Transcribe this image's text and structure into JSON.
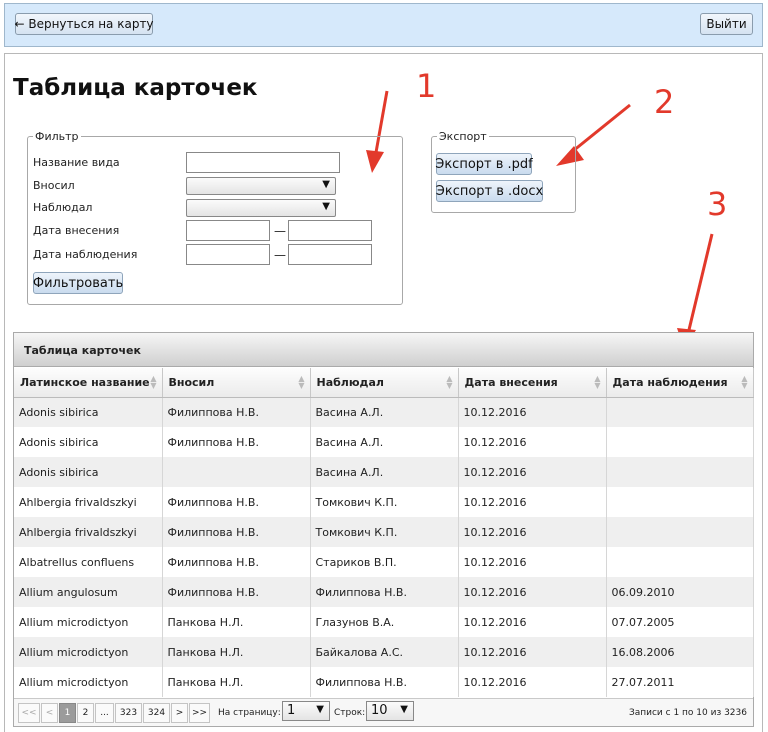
{
  "topbar": {
    "back_label": "← Вернуться на карту",
    "exit_label": "Выйти"
  },
  "page_title": "Таблица карточек",
  "annotations": [
    "1",
    "2",
    "3"
  ],
  "filter": {
    "legend": "Фильтр",
    "labels": {
      "species": "Название вида",
      "entered_by": "Вносил",
      "observed_by": "Наблюдал",
      "entry_date": "Дата внесения",
      "obs_date": "Дата наблюдения"
    },
    "dash": "—",
    "submit_label": "Фильтровать"
  },
  "export": {
    "legend": "Экспорт",
    "pdf_label": "Экспорт в .pdf",
    "docx_label": "Экспорт в .docx"
  },
  "grid": {
    "caption": "Таблица карточек",
    "columns": [
      "Латинское название",
      "Вносил",
      "Наблюдал",
      "Дата внесения",
      "Дата наблюдения"
    ],
    "rows": [
      [
        "Adonis sibirica",
        "Филиппова Н.В.",
        "Васина А.Л.",
        "10.12.2016",
        ""
      ],
      [
        "Adonis sibirica",
        "Филиппова Н.В.",
        "Васина А.Л.",
        "10.12.2016",
        ""
      ],
      [
        "Adonis sibirica",
        "",
        "Васина А.Л.",
        "10.12.2016",
        ""
      ],
      [
        "Ahlbergia frivaldszkyi",
        "Филиппова Н.В.",
        "Томкович К.П.",
        "10.12.2016",
        ""
      ],
      [
        "Ahlbergia frivaldszkyi",
        "Филиппова Н.В.",
        "Томкович К.П.",
        "10.12.2016",
        ""
      ],
      [
        "Albatrellus confluens",
        "Филиппова Н.В.",
        "Стариков В.П.",
        "10.12.2016",
        ""
      ],
      [
        "Allium angulosum",
        "Филиппова Н.В.",
        "Филиппова Н.В.",
        "10.12.2016",
        "06.09.2010"
      ],
      [
        "Allium microdictyon",
        "Панкова Н.Л.",
        "Глазунов В.А.",
        "10.12.2016",
        "07.07.2005"
      ],
      [
        "Allium microdictyon",
        "Панкова Н.Л.",
        "Байкалова А.С.",
        "10.12.2016",
        "16.08.2006"
      ],
      [
        "Allium microdictyon",
        "Панкова Н.Л.",
        "Филиппова Н.В.",
        "10.12.2016",
        "27.07.2011"
      ]
    ]
  },
  "pager": {
    "first": "<<",
    "prev": "<",
    "pages": [
      "1",
      "2",
      "...",
      "323",
      "324"
    ],
    "next": ">",
    "last": ">>",
    "current_page": "1",
    "page_label": "На страницу:",
    "page_value": "1",
    "rows_label": "Строк:",
    "rows_value": "10",
    "records": "Записи с 1 по 10 из 3236"
  },
  "icons": {
    "dropdown": "▼",
    "sort": "sort-arrows-icon"
  }
}
